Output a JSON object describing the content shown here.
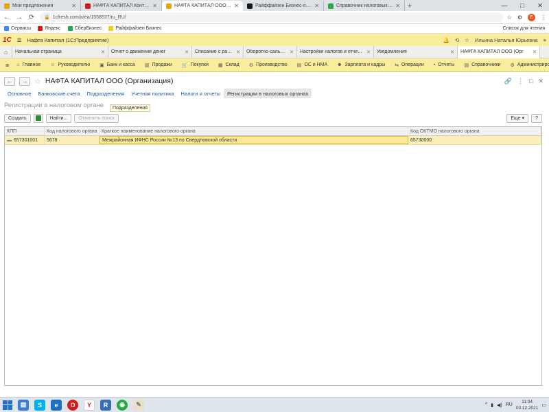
{
  "browser": {
    "tabs": [
      {
        "title": "Мои предложения",
        "fav_color": "#e8a50b",
        "active": false
      },
      {
        "title": "НАФТА КАПИТАЛ Контур.Фокус: гр",
        "fav_color": "#d61a1a",
        "active": false
      },
      {
        "title": "НАФТА КАПИТАЛ ООО (Организация)",
        "fav_color": "#e8a50b",
        "active": true
      },
      {
        "title": "Райффайзен Бизнес-онлайн",
        "fav_color": "#1a1a1a",
        "active": false
      },
      {
        "title": "Справочник налоговых ФНС",
        "fav_color": "#2aa847",
        "active": false
      }
    ],
    "new_tab": "+",
    "address": "1cfresh.com/a/ea/1558537/ru_RU/",
    "window_controls": [
      "—",
      "□",
      "✕"
    ],
    "avatar_letter": "Е"
  },
  "bookmarks": {
    "items": [
      {
        "label": "Сервисы",
        "color": "#4285f4"
      },
      {
        "label": "Яндекс",
        "color": "#d61a1a"
      },
      {
        "label": "СберБизнес",
        "color": "#2aa847"
      },
      {
        "label": "Райффайзен Бизнес",
        "color": "#e8d40b"
      }
    ],
    "right": "Список для чтения"
  },
  "app": {
    "logo": "1С",
    "title": "Нафта Капитал (1С:Предприятие)",
    "user": "Ильина Наталья Юрьевна"
  },
  "window_tabs": [
    {
      "label": "Начальная страница",
      "active": false
    },
    {
      "label": "Отчет о движении денег",
      "active": false
    },
    {
      "label": "Списание с расчетного счета",
      "active": false
    },
    {
      "label": "Оборотно-сальдовая",
      "active": false
    },
    {
      "label": "Настройки налогов и отчетов",
      "active": false
    },
    {
      "label": "Уведомления",
      "active": false
    },
    {
      "label": "НАФТА КАПИТАЛ ООО (Орг",
      "active": true
    }
  ],
  "sections": [
    "Главное",
    "Руководителю",
    "Банк и касса",
    "Продажи",
    "Покупки",
    "Склад",
    "Производство",
    "ОС и НМА",
    "Зарплата и кадры",
    "Операции",
    "Отчеты",
    "Справочники",
    "Администрирование"
  ],
  "form": {
    "title": "НАФТА КАПИТАЛ ООО (Организация)",
    "tabs": [
      {
        "label": "Основное",
        "active": false
      },
      {
        "label": "Банковские счета",
        "active": false
      },
      {
        "label": "Подразделения",
        "active": false
      },
      {
        "label": "Учетная политика",
        "active": false
      },
      {
        "label": "Налоги и отчеты",
        "active": false
      },
      {
        "label": "Регистрации в налоговых органах",
        "active": true
      }
    ],
    "subtitle": "Регистрации в налоговом органе",
    "tooltip": "Подразделения",
    "buttons": {
      "create": "Создать",
      "find": "Найти...",
      "cancel_search": "Отменить поиск",
      "more": "Еще",
      "help": "?"
    },
    "table": {
      "columns": [
        "КПП",
        "Код налогового органа",
        "Краткое наименование налогового органа",
        "Код ОКТМО налогового органа"
      ],
      "rows": [
        {
          "kpp": "657301001",
          "code": "5678",
          "name": "Межрайонная ИФНС России №13 по Свердловской области",
          "oktmo": "65730000"
        }
      ]
    }
  },
  "taskbar": {
    "clock_time": "11:04",
    "clock_date": "03.12.2021",
    "lang": "RU"
  }
}
